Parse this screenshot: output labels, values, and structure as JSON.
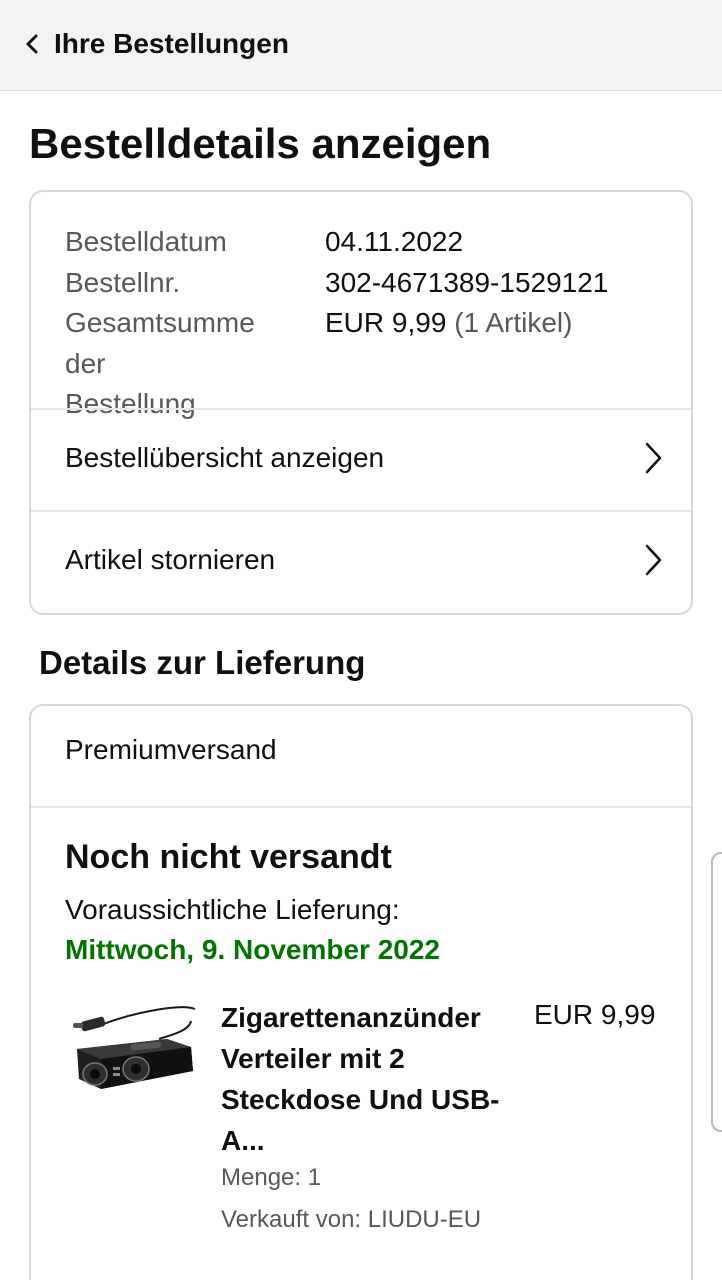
{
  "header": {
    "back_label": "Ihre Bestellungen"
  },
  "page_title": "Bestelldetails anzeigen",
  "order_info": {
    "date_label": "Bestelldatum",
    "date_value": "04.11.2022",
    "number_label": "Bestellnr.",
    "number_value": "302-4671389-1529121",
    "total_label_line1": "Gesamtsumme",
    "total_label_line2": "der Bestellung",
    "total_value": "EUR 9,99",
    "total_items": "(1 Artikel)"
  },
  "links": {
    "overview": "Bestellübersicht anzeigen",
    "cancel": "Artikel stornieren"
  },
  "delivery": {
    "section_title": "Details zur Lieferung",
    "shipping_type": "Premiumversand",
    "status": "Noch nicht versandt",
    "expected_label": "Voraussichtliche Lieferung:",
    "expected_date": "Mittwoch, 9. November 2022",
    "expected_date_color": "#007600"
  },
  "item": {
    "image_icon": "car-charger-splitter-image",
    "name": "Zigarettenanzünder Verteiler mit 2 Steckdose Und USB-A...",
    "price": "EUR 9,99",
    "quantity": "Menge: 1",
    "seller": "Verkauft von: LIUDU-EU"
  }
}
